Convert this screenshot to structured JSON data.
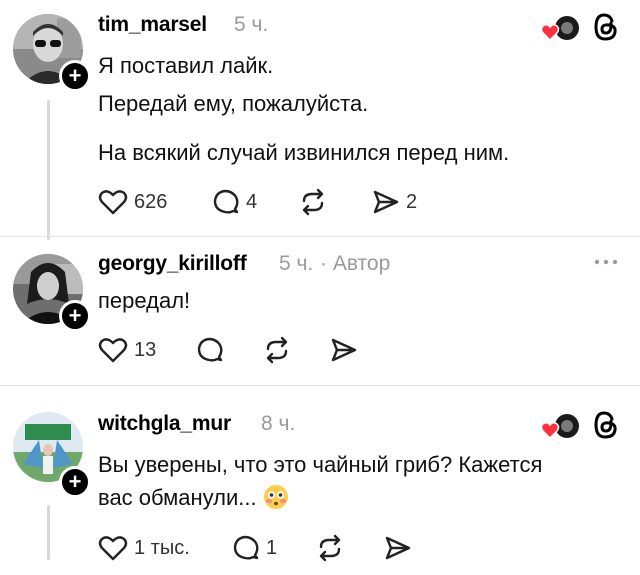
{
  "comments": [
    {
      "username": "tim_marsel",
      "time": "5 ч.",
      "lines": [
        "Я поставил лайк.",
        "Передай ему, пожалуйста.",
        "На всякий случай извинился перед ним."
      ],
      "likes": "626",
      "replies": "4",
      "reposts": "",
      "shares": "2"
    },
    {
      "username": "georgy_kirilloff",
      "time": "5 ч.",
      "badge": "· Автор",
      "lines": [
        "передал!"
      ],
      "likes": "13",
      "replies": "",
      "reposts": "",
      "shares": ""
    },
    {
      "username": "witchgla_mur",
      "time": "8 ч.",
      "lines": [
        "Вы уверены, что это чайный гриб? Кажется",
        "вас обманули..."
      ],
      "likes": "1 тыс.",
      "replies": "1",
      "reposts": "",
      "shares": ""
    }
  ],
  "icons": {
    "like": "heart-icon",
    "reply": "comment-icon",
    "repost": "repost-icon",
    "share": "send-icon",
    "threads": "threads-logo-icon",
    "more": "more-icon"
  },
  "colors": {
    "liked_heart": "#ff3040",
    "secondary_text": "#9a9a9a"
  }
}
